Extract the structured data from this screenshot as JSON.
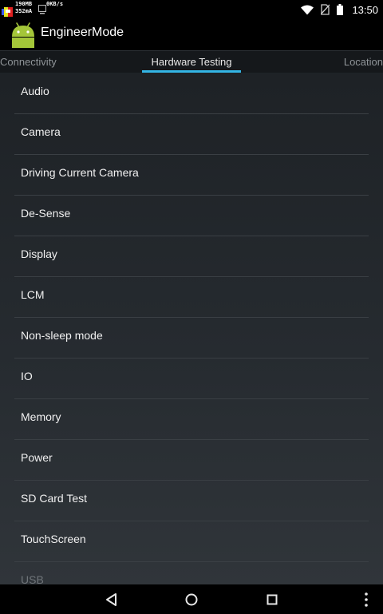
{
  "status_bar": {
    "mem_text": "190MB",
    "current_text": "352mA",
    "net_speed": "0KB/s",
    "time": "13:50",
    "icons": [
      "wifi-icon",
      "no-sim-icon",
      "battery-icon"
    ]
  },
  "action_bar": {
    "app_icon": "android-robot-icon",
    "title": "EngineerMode"
  },
  "tabs": [
    {
      "label": "Connectivity",
      "selected": false
    },
    {
      "label": "Hardware Testing",
      "selected": true
    },
    {
      "label": "Location",
      "selected": false
    }
  ],
  "list": {
    "items": [
      {
        "label": "Audio"
      },
      {
        "label": "Camera"
      },
      {
        "label": "Driving Current Camera"
      },
      {
        "label": "De-Sense"
      },
      {
        "label": "Display"
      },
      {
        "label": "LCM"
      },
      {
        "label": "Non-sleep mode"
      },
      {
        "label": "IO"
      },
      {
        "label": "Memory"
      },
      {
        "label": "Power"
      },
      {
        "label": "SD Card Test"
      },
      {
        "label": "TouchScreen"
      },
      {
        "label": "USB"
      }
    ]
  },
  "nav_bar": {
    "buttons": [
      "back-icon",
      "home-icon",
      "recents-icon",
      "overflow-menu-icon"
    ]
  },
  "colors": {
    "accent": "#33b5e5",
    "android_green": "#a4c639"
  }
}
